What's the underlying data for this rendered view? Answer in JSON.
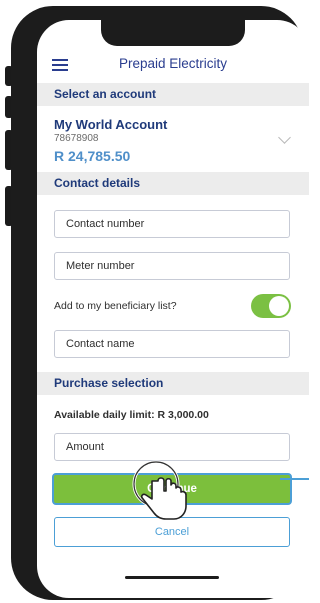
{
  "header": {
    "title": "Prepaid Electricity",
    "menu_icon": "hamburger-menu-icon"
  },
  "sections": {
    "account": "Select an account",
    "contact": "Contact details",
    "purchase": "Purchase selection"
  },
  "account": {
    "name": "My World Account",
    "number": "78678908",
    "balance": "R 24,785.50"
  },
  "fields": {
    "contact_number": "Contact number",
    "meter_number": "Meter number",
    "contact_name": "Contact name",
    "amount": "Amount"
  },
  "beneficiary": {
    "label": "Add to my beneficiary list?",
    "enabled": true
  },
  "limit": "Available daily limit: R 3,000.00",
  "buttons": {
    "continue": "Continue",
    "cancel": "Cancel"
  },
  "colors": {
    "brand": "#1f3a7a",
    "accent": "#7cbf3c",
    "link": "#4c9fd6"
  }
}
